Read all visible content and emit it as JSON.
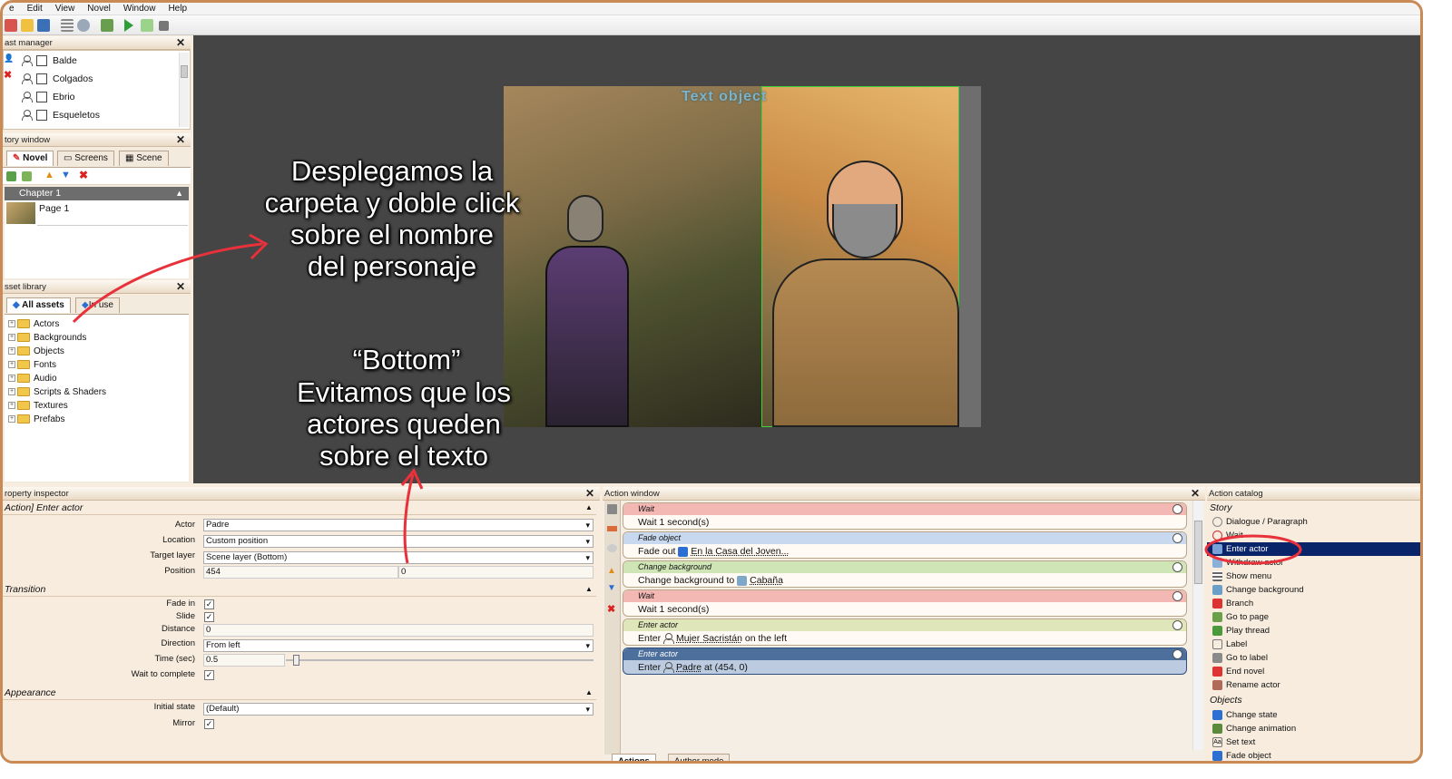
{
  "menu": [
    "e",
    "Edit",
    "View",
    "Novel",
    "Window",
    "Help"
  ],
  "cast_manager": {
    "title": "ast manager",
    "items": [
      "Balde",
      "Colgados",
      "Ebrio",
      "Esqueletos"
    ]
  },
  "story_window": {
    "title": "tory window",
    "tabs": [
      "Novel",
      "Screens",
      "Scene"
    ],
    "chapter": "Chapter 1",
    "page": "Page 1"
  },
  "asset_library": {
    "title": "sset library",
    "tabs": [
      "All assets",
      "In use"
    ],
    "folders": [
      "Actors",
      "Backgrounds",
      "Objects",
      "Fonts",
      "Audio",
      "Scripts & Shaders",
      "Textures",
      "Prefabs"
    ]
  },
  "scene": {
    "text_object": "Text object"
  },
  "annotations": {
    "top": "Desplegamos la\ncarpeta y doble click\nsobre el nombre\ndel personaje",
    "bottom_title": "“Bottom”",
    "bottom_text": "Evitamos que los\nactores queden\nsobre el texto"
  },
  "property_inspector": {
    "title": "roperty inspector",
    "header": "Action] Enter actor",
    "actor_label": "Actor",
    "actor_value": "Padre",
    "location_label": "Location",
    "location_value": "Custom position",
    "target_layer_label": "Target layer",
    "target_layer_value": "Scene layer (Bottom)",
    "position_label": "Position",
    "position_x": "454",
    "position_y": "0",
    "transition_section": "Transition",
    "fade_in_label": "Fade in",
    "slide_label": "Slide",
    "distance_label": "Distance",
    "distance_value": "0",
    "direction_label": "Direction",
    "direction_value": "From left",
    "time_label": "Time (sec)",
    "time_value": "0.5",
    "wait_label": "Wait to complete",
    "appearance_section": "Appearance",
    "initial_state_label": "Initial state",
    "initial_state_value": "(Default)",
    "mirror_label": "Mirror"
  },
  "action_window": {
    "title": "Action window",
    "actions": [
      {
        "type": "Wait",
        "pre": "Wait 1 second(s)",
        "obj": "",
        "post": "",
        "color": "#f3b7b4"
      },
      {
        "type": "Fade object",
        "pre": "Fade out ",
        "obj": "En la Casa del Joven...",
        "post": "",
        "color": "#c8d8ee"
      },
      {
        "type": "Change background",
        "pre": "Change background to ",
        "obj": "Cabaña",
        "post": "",
        "color": "#cfe5b5"
      },
      {
        "type": "Wait",
        "pre": "Wait 1 second(s)",
        "obj": "",
        "post": "",
        "color": "#f3b7b4"
      },
      {
        "type": "Enter actor",
        "pre": "Enter ",
        "obj": "Mujer Sacristán",
        "post": " on the left",
        "color": "#dfe6b9"
      },
      {
        "type": "Enter actor",
        "pre": "Enter ",
        "obj": "Padre",
        "post": " at (454, 0)",
        "color": "#4d6f9c"
      }
    ],
    "bottom_tabs": [
      "Actions",
      "Author mode"
    ]
  },
  "action_catalog": {
    "title": "Action catalog",
    "story_section": "Story",
    "story_items": [
      "Dialogue / Paragraph",
      "Wait",
      "Enter actor",
      "Withdraw actor",
      "Show menu",
      "Change background",
      "Branch",
      "Go to page",
      "Play thread",
      "Label",
      "Go to label",
      "End novel",
      "Rename actor"
    ],
    "objects_section": "Objects",
    "object_items": [
      "Change state",
      "Change animation",
      "Set text",
      "Fade object"
    ]
  },
  "colors": {
    "frame": "#c98a55",
    "highlight": "#0a246a",
    "annotation_arrow": "#e8313b"
  }
}
